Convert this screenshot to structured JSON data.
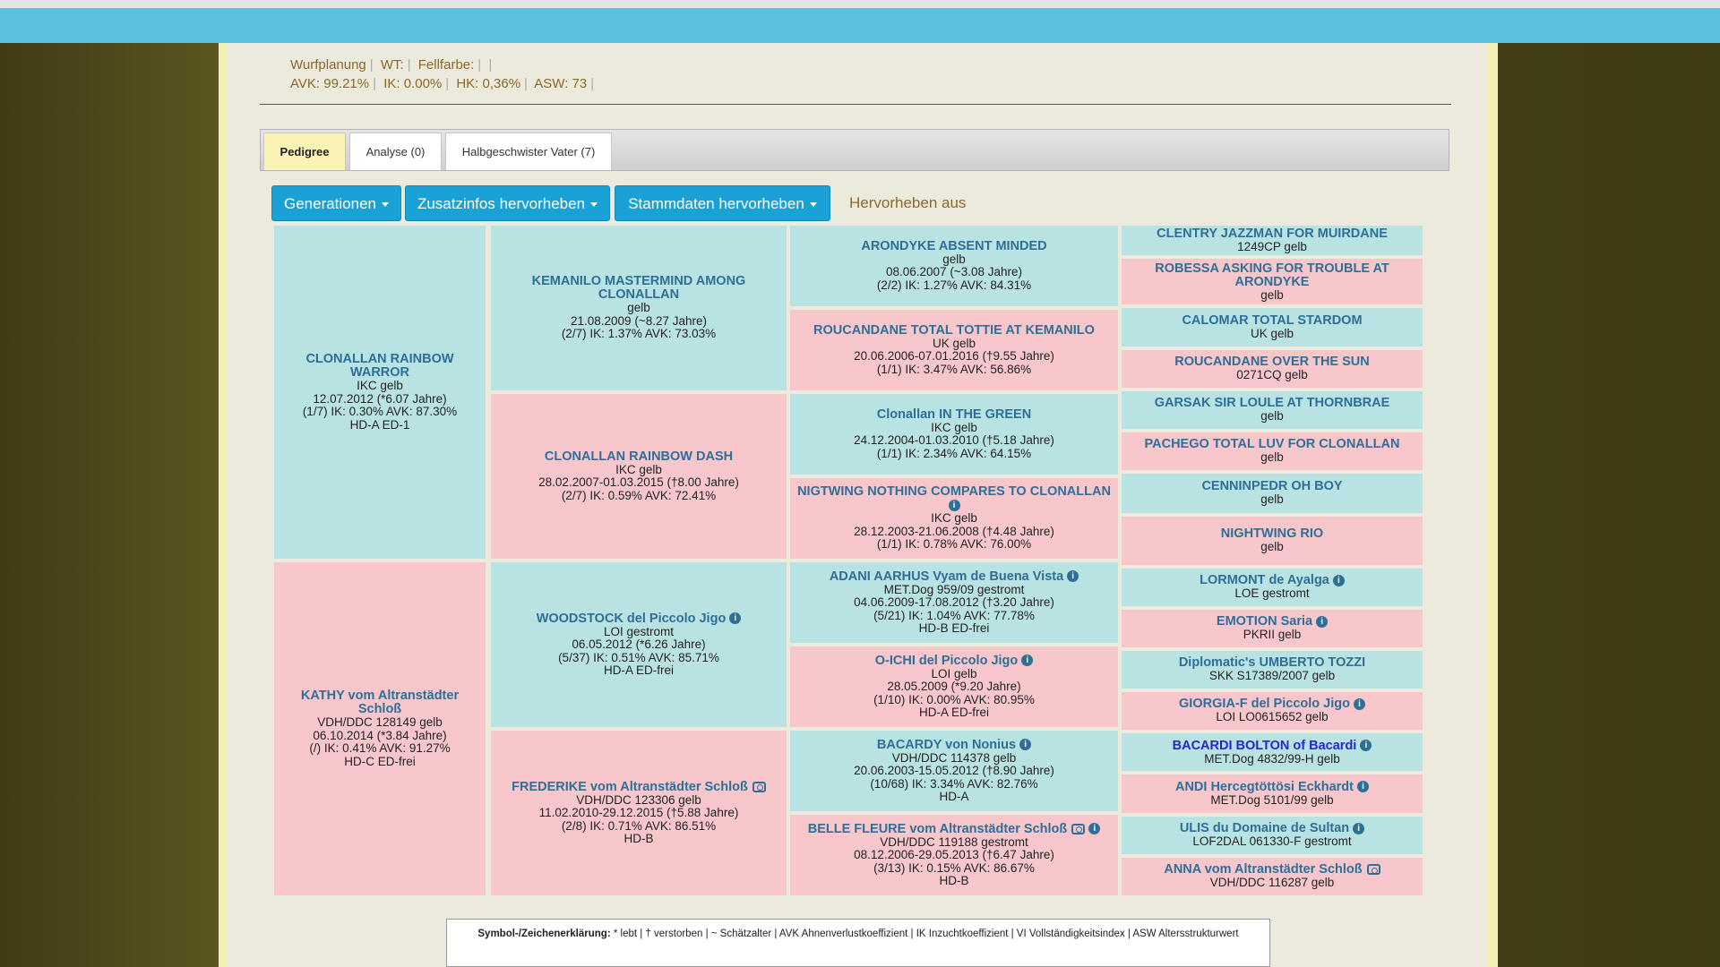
{
  "header": {
    "wurfplanung": "Wurfplanung",
    "wt": "WT:",
    "fellfarbe": "Fellfarbe:",
    "avk": "AVK: 99.21%",
    "ik": "IK: 0.00%",
    "hk": "HK: 0,36%",
    "asw": "ASW: 73"
  },
  "tabs": [
    "Pedigree",
    "Analyse (0)",
    "Halbgeschwister Vater (7)"
  ],
  "toolbar": {
    "generationen": "Generationen",
    "zusatzinfos": "Zusatzinfos hervorheben",
    "stammdaten": "Stammdaten hervorheben",
    "hervorheben_aus": "Hervorheben aus"
  },
  "pedigree": [
    {
      "sex": "m",
      "name": "CLONALLAN RAINBOW WARROR",
      "lines": [
        "IKC gelb",
        "12.07.2012 (*6.07 Jahre)",
        "(1/7) IK: 0.30% AVK: 87.30%",
        "HD-A ED-1"
      ]
    },
    {
      "sex": "f",
      "name": "KATHY vom Altranstädter Schloß",
      "lines": [
        "VDH/DDC 128149 gelb",
        "06.10.2014 (*3.84 Jahre)",
        "(/) IK: 0.41% AVK: 91.27%",
        "HD-C ED-frei"
      ]
    },
    {
      "sex": "m",
      "name": "KEMANILO MASTERMIND AMONG CLONALLAN",
      "lines": [
        "gelb",
        "21.08.2009 (~8.27 Jahre)",
        "(2/7) IK: 1.37% AVK: 73.03%"
      ]
    },
    {
      "sex": "f",
      "name": "CLONALLAN RAINBOW DASH",
      "lines": [
        "IKC gelb",
        "28.02.2007-01.03.2015 (†8.00 Jahre)",
        "(2/7) IK: 0.59% AVK: 72.41%"
      ]
    },
    {
      "sex": "m",
      "name": "WOODSTOCK del Piccolo Jigo",
      "info": true,
      "lines": [
        "LOI gestromt",
        "06.05.2012 (*6.26 Jahre)",
        "(5/37) IK: 0.51% AVK: 85.71%",
        "HD-A ED-frei"
      ]
    },
    {
      "sex": "f",
      "name": "FREDERIKE vom Altranstädter Schloß",
      "camera": true,
      "lines": [
        "VDH/DDC 123306 gelb",
        "11.02.2010-29.12.2015 (†5.88 Jahre)",
        "(2/8) IK: 0.71% AVK: 86.51%",
        "HD-B"
      ]
    },
    {
      "sex": "m",
      "name": "ARONDYKE ABSENT MINDED",
      "lines": [
        "gelb",
        "08.06.2007 (~3.08 Jahre)",
        "(2/2) IK: 1.27% AVK: 84.31%"
      ]
    },
    {
      "sex": "f",
      "name": "ROUCANDANE TOTAL TOTTIE AT KEMANILO",
      "lines": [
        "UK gelb",
        "20.06.2006-07.01.2016 (†9.55 Jahre)",
        "(1/1) IK: 3.47% AVK: 56.86%"
      ]
    },
    {
      "sex": "m",
      "name": "Clonallan IN THE GREEN",
      "lines": [
        "IKC gelb",
        "24.12.2004-01.03.2010 (†5.18 Jahre)",
        "(1/1) IK: 2.34% AVK: 64.15%"
      ]
    },
    {
      "sex": "f",
      "name": "NIGTWING NOTHING COMPARES TO CLONALLAN",
      "infoBelow": true,
      "lines": [
        "IKC gelb",
        "28.12.2003-21.06.2008 (†4.48 Jahre)",
        "(1/1) IK: 0.78% AVK: 76.00%"
      ]
    },
    {
      "sex": "m",
      "name": "ADANI AARHUS Vyam de Buena Vista",
      "info": true,
      "lines": [
        "MET.Dog 959/09 gestromt",
        "04.06.2009-17.08.2012 (†3.20 Jahre)",
        "(5/21) IK: 1.04% AVK: 77.78%",
        "HD-B ED-frei"
      ]
    },
    {
      "sex": "f",
      "name": "O-ICHI del Piccolo Jigo",
      "info": true,
      "lines": [
        "LOI gelb",
        "28.05.2009 (*9.20 Jahre)",
        "(1/10) IK: 0.00% AVK: 80.95%",
        "HD-A ED-frei"
      ]
    },
    {
      "sex": "m",
      "name": "BACARDY von Nonius",
      "info": true,
      "lines": [
        "VDH/DDC 114378 gelb",
        "20.06.2003-15.05.2012 (†8.90 Jahre)",
        "(10/68) IK: 3.34% AVK: 82.76%",
        "HD-A"
      ]
    },
    {
      "sex": "f",
      "name": "BELLE FLEURE vom Altranstädter Schloß",
      "camera": true,
      "info": true,
      "lines": [
        "VDH/DDC 119188 gestromt",
        "08.12.2006-29.05.2013 (†6.47 Jahre)",
        "(3/13) IK: 0.15% AVK: 86.67%",
        "HD-B"
      ]
    },
    {
      "sex": "m",
      "name": "CLENTRY JAZZMAN FOR MUIRDANE",
      "lines": [
        "1249CP gelb"
      ]
    },
    {
      "sex": "f",
      "name": "ROBESSA ASKING FOR TROUBLE AT ARONDYKE",
      "lines": [
        "gelb"
      ]
    },
    {
      "sex": "m",
      "name": "CALOMAR TOTAL STARDOM",
      "lines": [
        "UK gelb"
      ]
    },
    {
      "sex": "f",
      "name": "ROUCANDANE OVER THE SUN",
      "lines": [
        "0271CQ gelb"
      ]
    },
    {
      "sex": "m",
      "name": "GARSAK SIR LOULE AT THORNBRAE",
      "lines": [
        "gelb"
      ]
    },
    {
      "sex": "f",
      "name": "PACHEGO TOTAL LUV FOR CLONALLAN",
      "lines": [
        "gelb"
      ]
    },
    {
      "sex": "m",
      "name": "CENNINPEDR OH BOY",
      "lines": [
        "gelb"
      ]
    },
    {
      "sex": "f",
      "name": "NIGHTWING RIO",
      "lines": [
        "gelb"
      ]
    },
    {
      "sex": "m",
      "name": "LORMONT de Ayalga",
      "info": true,
      "lines": [
        "LOE gestromt"
      ]
    },
    {
      "sex": "f",
      "name": "EMOTION Saria",
      "info": true,
      "lines": [
        "PKRII gelb"
      ]
    },
    {
      "sex": "m",
      "name": "Diplomatic's UMBERTO TOZZI",
      "lines": [
        "SKK S17389/2007 gelb"
      ]
    },
    {
      "sex": "f",
      "name": "GIORGIA-F del Piccolo Jigo",
      "info": true,
      "lines": [
        "LOI LO0615652 gelb"
      ]
    },
    {
      "sex": "m",
      "name": "BACARDI BOLTON of Bacardi",
      "info": true,
      "blue": true,
      "lines": [
        "MET.Dog 4832/99-H gelb"
      ]
    },
    {
      "sex": "f",
      "name": "ANDI Hercegtöttösi Eckhardt",
      "info": true,
      "lines": [
        "MET.Dog 5101/99 gelb"
      ]
    },
    {
      "sex": "m",
      "name": "ULIS du Domaine de Sultan",
      "info": true,
      "lines": [
        "LOF2DAL 061330-F gestromt"
      ]
    },
    {
      "sex": "f",
      "name": "ANNA vom Altranstädter Schloß",
      "camera": true,
      "lines": [
        "VDH/DDC 116287 gelb"
      ]
    }
  ],
  "legend": {
    "title": "Symbol-/Zeichenerklärung:",
    "text": "* lebt | † verstorben | ~ Schätzalter | AVK Ahnenverlustkoeffizient | IK Inzuchtkoeffizient | VI Vollständigkeitsindex | ASW Altersstrukturwert"
  }
}
